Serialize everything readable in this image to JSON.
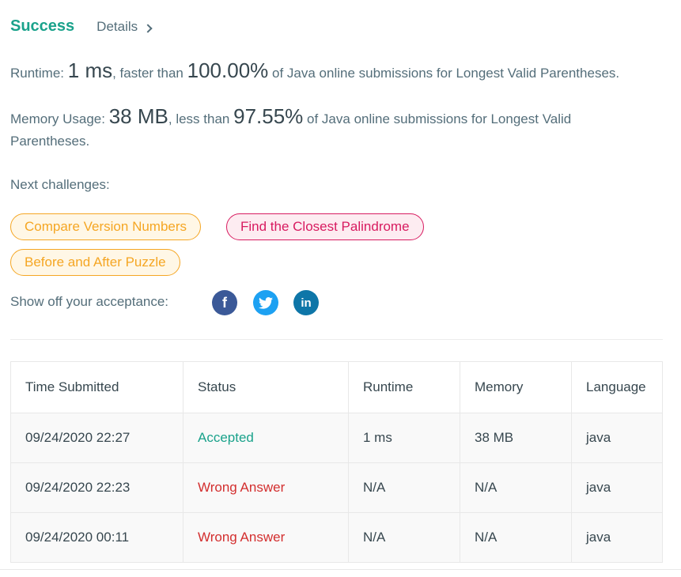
{
  "header": {
    "result_label": "Success",
    "details_label": "Details"
  },
  "runtime": {
    "label": "Runtime:",
    "value": "1 ms",
    "compare": ", faster than",
    "percent": "100.00%",
    "tail": "of Java online submissions for Longest Valid Parentheses."
  },
  "memory": {
    "label": "Memory Usage:",
    "value": "38 MB",
    "compare": ", less than",
    "percent": "97.55%",
    "tail": "of Java online submissions for Longest Valid Parentheses."
  },
  "next": {
    "label": "Next challenges:",
    "challenges": [
      {
        "title": "Compare Version Numbers",
        "difficulty": "medium"
      },
      {
        "title": "Find the Closest Palindrome",
        "difficulty": "hard"
      },
      {
        "title": "Before and After Puzzle",
        "difficulty": "medium"
      }
    ]
  },
  "share": {
    "label": "Show off your acceptance:",
    "icons": [
      "facebook-icon",
      "twitter-icon",
      "linkedin-icon"
    ]
  },
  "table": {
    "headers": [
      "Time Submitted",
      "Status",
      "Runtime",
      "Memory",
      "Language"
    ],
    "rows": [
      {
        "time": "09/24/2020 22:27",
        "status": "Accepted",
        "runtime": "1 ms",
        "memory": "38 MB",
        "language": "java"
      },
      {
        "time": "09/24/2020 22:23",
        "status": "Wrong Answer",
        "runtime": "N/A",
        "memory": "N/A",
        "language": "java"
      },
      {
        "time": "09/24/2020 00:11",
        "status": "Wrong Answer",
        "runtime": "N/A",
        "memory": "N/A",
        "language": "java"
      }
    ]
  },
  "colors": {
    "success": "#1aa28b",
    "wrong": "#d32f2f",
    "medium": "#f5a623",
    "hard": "#d81b60"
  }
}
